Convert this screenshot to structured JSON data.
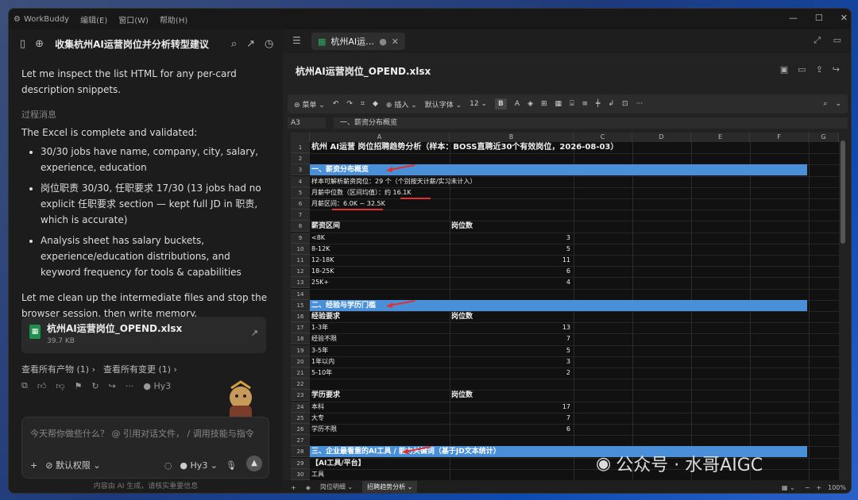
{
  "titlebar": {
    "app_name": "WorkBuddy",
    "menu": [
      "编辑(E)",
      "窗口(W)",
      "帮助(H)"
    ]
  },
  "chat": {
    "title": "收集杭州AI运营岗位并分析转型建议",
    "msg1": "Let me inspect the list HTML for any per-card description snippets.",
    "process_label": "过程消息",
    "msg2": "The Excel is complete and validated:",
    "bullets": [
      "30/30 jobs have name, company, city, salary, experience, education",
      "岗位职责 30/30, 任职要求 17/30 (13 jobs had no explicit 任职要求 section — kept full JD in 职责, which is accurate)",
      "Analysis sheet has salary buckets, experience/education distributions, and keyword frequency for tools & capabilities"
    ],
    "msg3": "Let me clean up the intermediate files and stop the browser session, then write memory.",
    "file_name": "杭州AI运营岗位_OPEND.xlsx",
    "file_size": "39.7 KB",
    "link_products": "查看所有产物 (1)",
    "link_changes": "查看所有变更 (1)",
    "model": "Hy3",
    "input_placeholder": "今天帮你做些什么？ @ 引用对话文件， / 调用技能与指令",
    "permission": "默认权限",
    "disclaimer": "内容由 AI 生成，请核实重要信息"
  },
  "doc": {
    "tab_label": "杭州AI运…",
    "title": "杭州AI运营岗位_OPEND.xlsx",
    "toolbar": {
      "menu": "菜单",
      "insert": "插入",
      "font": "默认字体",
      "size": "12",
      "bold": "B"
    },
    "cell_ref": "A3",
    "formula": "一、薪资分布概览",
    "columns": [
      "A",
      "B",
      "C",
      "D",
      "E",
      "F",
      "G"
    ],
    "sheet_tabs": [
      "岗位明细",
      "招聘趋势分析"
    ],
    "zoom": "100%"
  },
  "sheet": {
    "r1": "杭州 AI运营 岗位招聘趋势分析（样本：BOSS直聘近30个有效岗位，2026-08-03）",
    "r3": "一、薪资分布概览",
    "r4": "样本可解析薪资岗位：29 个（个别按天计薪/实习未计入）",
    "r5": "月薪中位数（区间均值）：约 16.1K",
    "r6": "月薪区间：6.0K ~ 32.5K",
    "h_salary": "薪资区间",
    "h_count": "岗位数",
    "salary": [
      [
        "<8K",
        "3"
      ],
      [
        "8-12K",
        "5"
      ],
      [
        "12-18K",
        "11"
      ],
      [
        "18-25K",
        "6"
      ],
      [
        "25K+",
        "4"
      ]
    ],
    "r15": "二、经验与学历门槛",
    "h_exp": "经验要求",
    "exp": [
      [
        "1-3年",
        "13"
      ],
      [
        "经验不限",
        "7"
      ],
      [
        "3-5年",
        "5"
      ],
      [
        "1年以内",
        "3"
      ],
      [
        "5-10年",
        "2"
      ]
    ],
    "h_edu": "学历要求",
    "edu": [
      [
        "本科",
        "17"
      ],
      [
        "大专",
        "7"
      ],
      [
        "学历不限",
        "6"
      ]
    ],
    "r28": "三、企业最看重的AI工具 / 能力关键词（基于JD文本统计）",
    "r29": "【AI工具/平台】",
    "r30": "工具"
  },
  "watermark": "公众号 · 水哥AIGC"
}
